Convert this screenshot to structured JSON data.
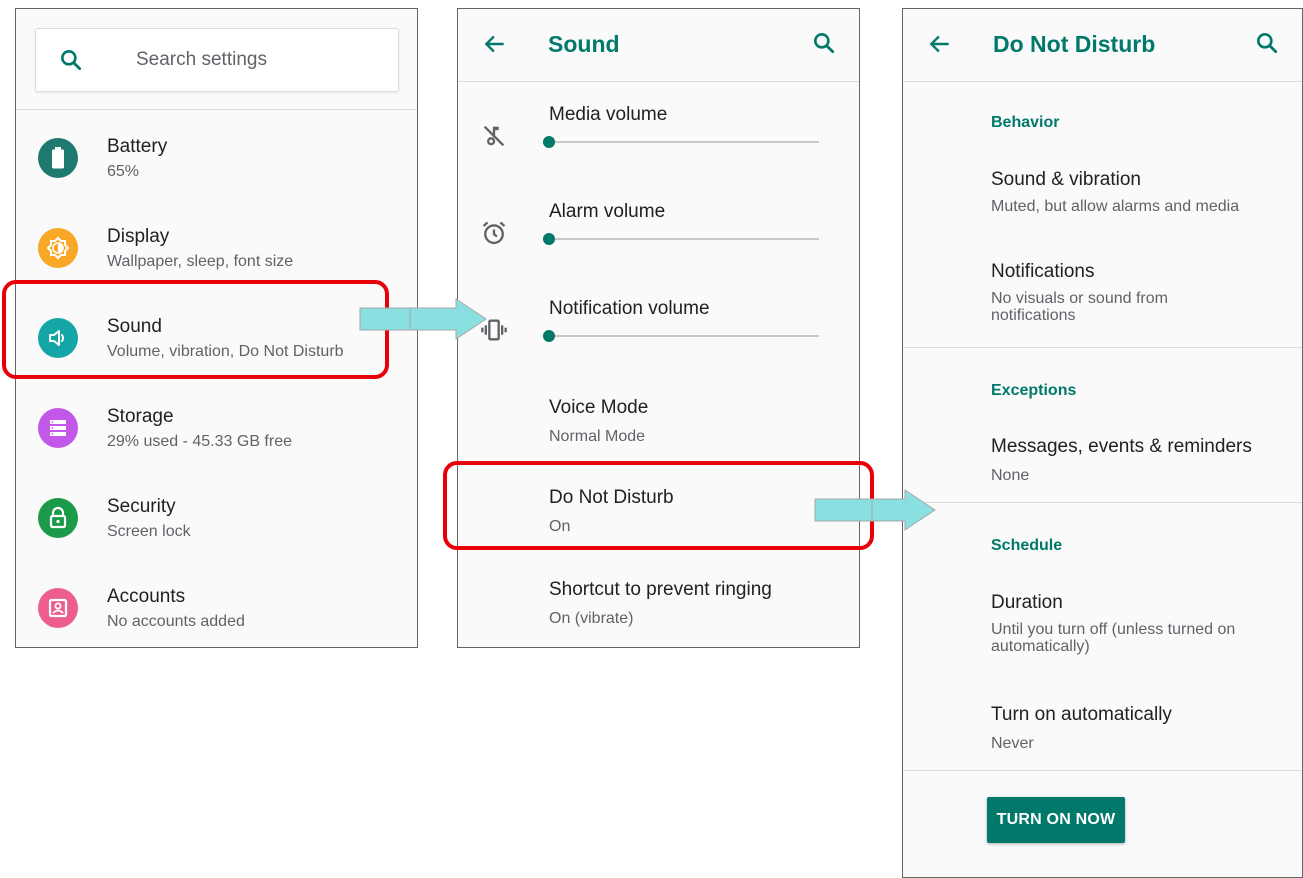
{
  "settings_panel": {
    "search_placeholder": "Search settings",
    "items": [
      {
        "title": "Battery",
        "subtitle": "65%",
        "icon": "battery-icon",
        "color": "#1e7a6e"
      },
      {
        "title": "Display",
        "subtitle": "Wallpaper, sleep, font size",
        "icon": "brightness-icon",
        "color": "#f9a825"
      },
      {
        "title": "Sound",
        "subtitle": "Volume, vibration, Do Not Disturb",
        "icon": "volume-icon",
        "color": "#14a6a6"
      },
      {
        "title": "Storage",
        "subtitle": "29% used - 45.33 GB free",
        "icon": "storage-icon",
        "color": "#c158e8"
      },
      {
        "title": "Security",
        "subtitle": "Screen lock",
        "icon": "lock-icon",
        "color": "#1b9a4a"
      },
      {
        "title": "Accounts",
        "subtitle": "No accounts added",
        "icon": "account-icon",
        "color": "#ec5f8c"
      }
    ]
  },
  "sound_panel": {
    "title": "Sound",
    "volumes": [
      {
        "label": "Media volume",
        "icon": "music-off-icon",
        "level": 0
      },
      {
        "label": "Alarm volume",
        "icon": "alarm-icon",
        "level": 0
      },
      {
        "label": "Notification volume",
        "icon": "vibrate-icon",
        "level": 0
      }
    ],
    "items": [
      {
        "title": "Voice Mode",
        "subtitle": "Normal Mode"
      },
      {
        "title": "Do Not Disturb",
        "subtitle": "On"
      },
      {
        "title": "Shortcut to prevent ringing",
        "subtitle": "On (vibrate)"
      }
    ]
  },
  "dnd_panel": {
    "title": "Do Not Disturb",
    "behavior_header": "Behavior",
    "sound_vibration": {
      "title": "Sound & vibration",
      "subtitle": "Muted, but allow alarms and media"
    },
    "notifications": {
      "title": "Notifications",
      "subtitle": "No visuals or sound from notifications"
    },
    "exceptions_header": "Exceptions",
    "messages": {
      "title": "Messages, events & reminders",
      "subtitle": "None"
    },
    "schedule_header": "Schedule",
    "duration": {
      "title": "Duration",
      "subtitle": "Until you turn off (unless turned on automatically)"
    },
    "turn_on_auto": {
      "title": "Turn on automatically",
      "subtitle": "Never"
    },
    "button_label": "TURN ON NOW"
  },
  "colors": {
    "accent": "#00796b",
    "highlight": "#e8000b",
    "arrow": "#8adfe0"
  }
}
